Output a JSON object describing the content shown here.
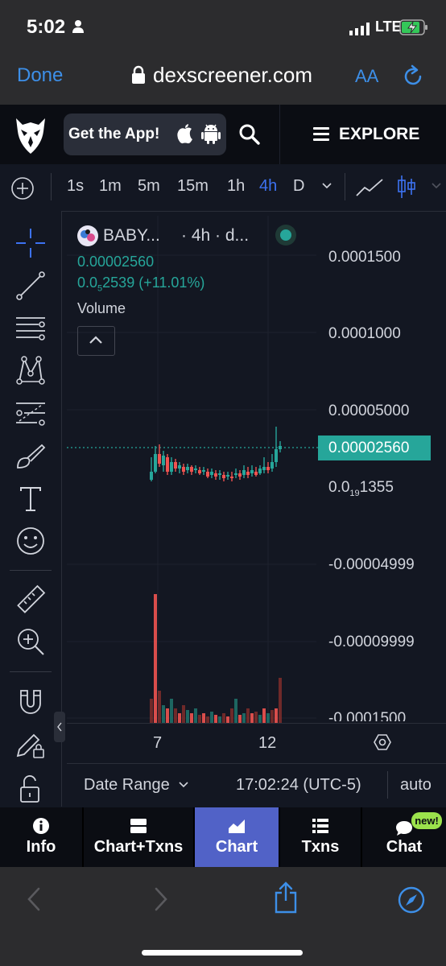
{
  "status": {
    "time": "5:02",
    "network": "LTE"
  },
  "browser": {
    "done_label": "Done",
    "url": "dexscreener.com",
    "text_size_label": "AA"
  },
  "header": {
    "get_app_label": "Get the App!",
    "explore_label": "EXPLORE"
  },
  "toolbar": {
    "timeframes": [
      "1s",
      "1m",
      "5m",
      "15m",
      "1h",
      "4h",
      "D"
    ],
    "active_timeframe": "4h",
    "accent": "#3d72f2"
  },
  "chart": {
    "symbol_label": "BABY...",
    "interval_label": "· 4h · d...",
    "price": "0.00002560",
    "change_prefix": "0.0",
    "change_sub": "5",
    "change_rest": "2539 (+11.01%)",
    "volume_label": "Volume",
    "price_tag": "0.00002560",
    "low_prefix": "0.0",
    "low_sub": "19",
    "low_rest": "1355",
    "up_color": "#26a69a",
    "down_color": "#ef5350"
  },
  "chart_data": {
    "type": "candlestick",
    "y_ticks": [
      "0.0001500",
      "0.0001000",
      "0.00005000",
      "-0.00004999",
      "-0.00009999",
      "-0.0001500"
    ],
    "x_ticks": [
      "7",
      "12"
    ],
    "last_price": 2.56e-05
  },
  "datebar": {
    "date_range_label": "Date Range",
    "time": "17:02:24 (UTC-5)",
    "auto_label": "auto"
  },
  "tabs": [
    {
      "label": "Info"
    },
    {
      "label": "Chart+Txns"
    },
    {
      "label": "Chart"
    },
    {
      "label": "Txns"
    },
    {
      "label": "Chat",
      "badge": "new!"
    }
  ],
  "active_tab": "Chart"
}
